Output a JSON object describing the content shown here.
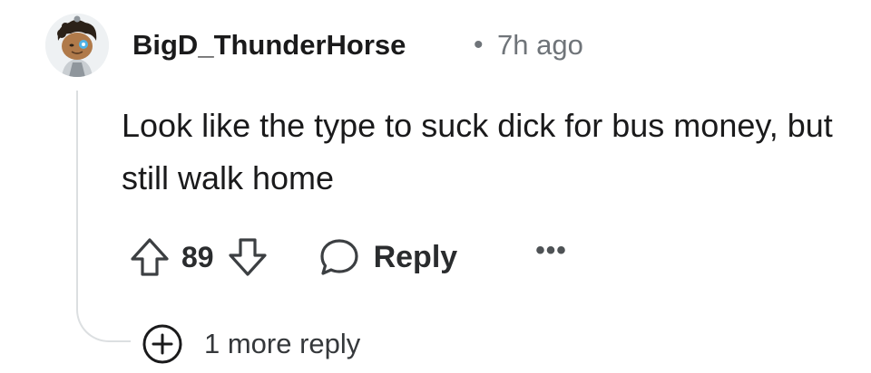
{
  "comment": {
    "username": "BigD_ThunderHorse",
    "separator": "•",
    "timestamp": "7h ago",
    "body": "Look like the type to suck dick for bus money, but still walk home",
    "avatar_icon": "snoo-avatar"
  },
  "actions": {
    "upvote_icon": "arrow-up-icon",
    "vote_count": "89",
    "downvote_icon": "arrow-down-icon",
    "reply_icon": "speech-bubble-icon",
    "reply_label": "Reply",
    "more_label": "•••"
  },
  "thread": {
    "expand_icon": "plus-circle-icon",
    "more_replies_label": "1 more reply"
  },
  "colors": {
    "text_primary": "#1a1a1b",
    "text_secondary": "#6f7479",
    "icon": "#3c3f42",
    "thread_line": "#dcdfe1"
  }
}
